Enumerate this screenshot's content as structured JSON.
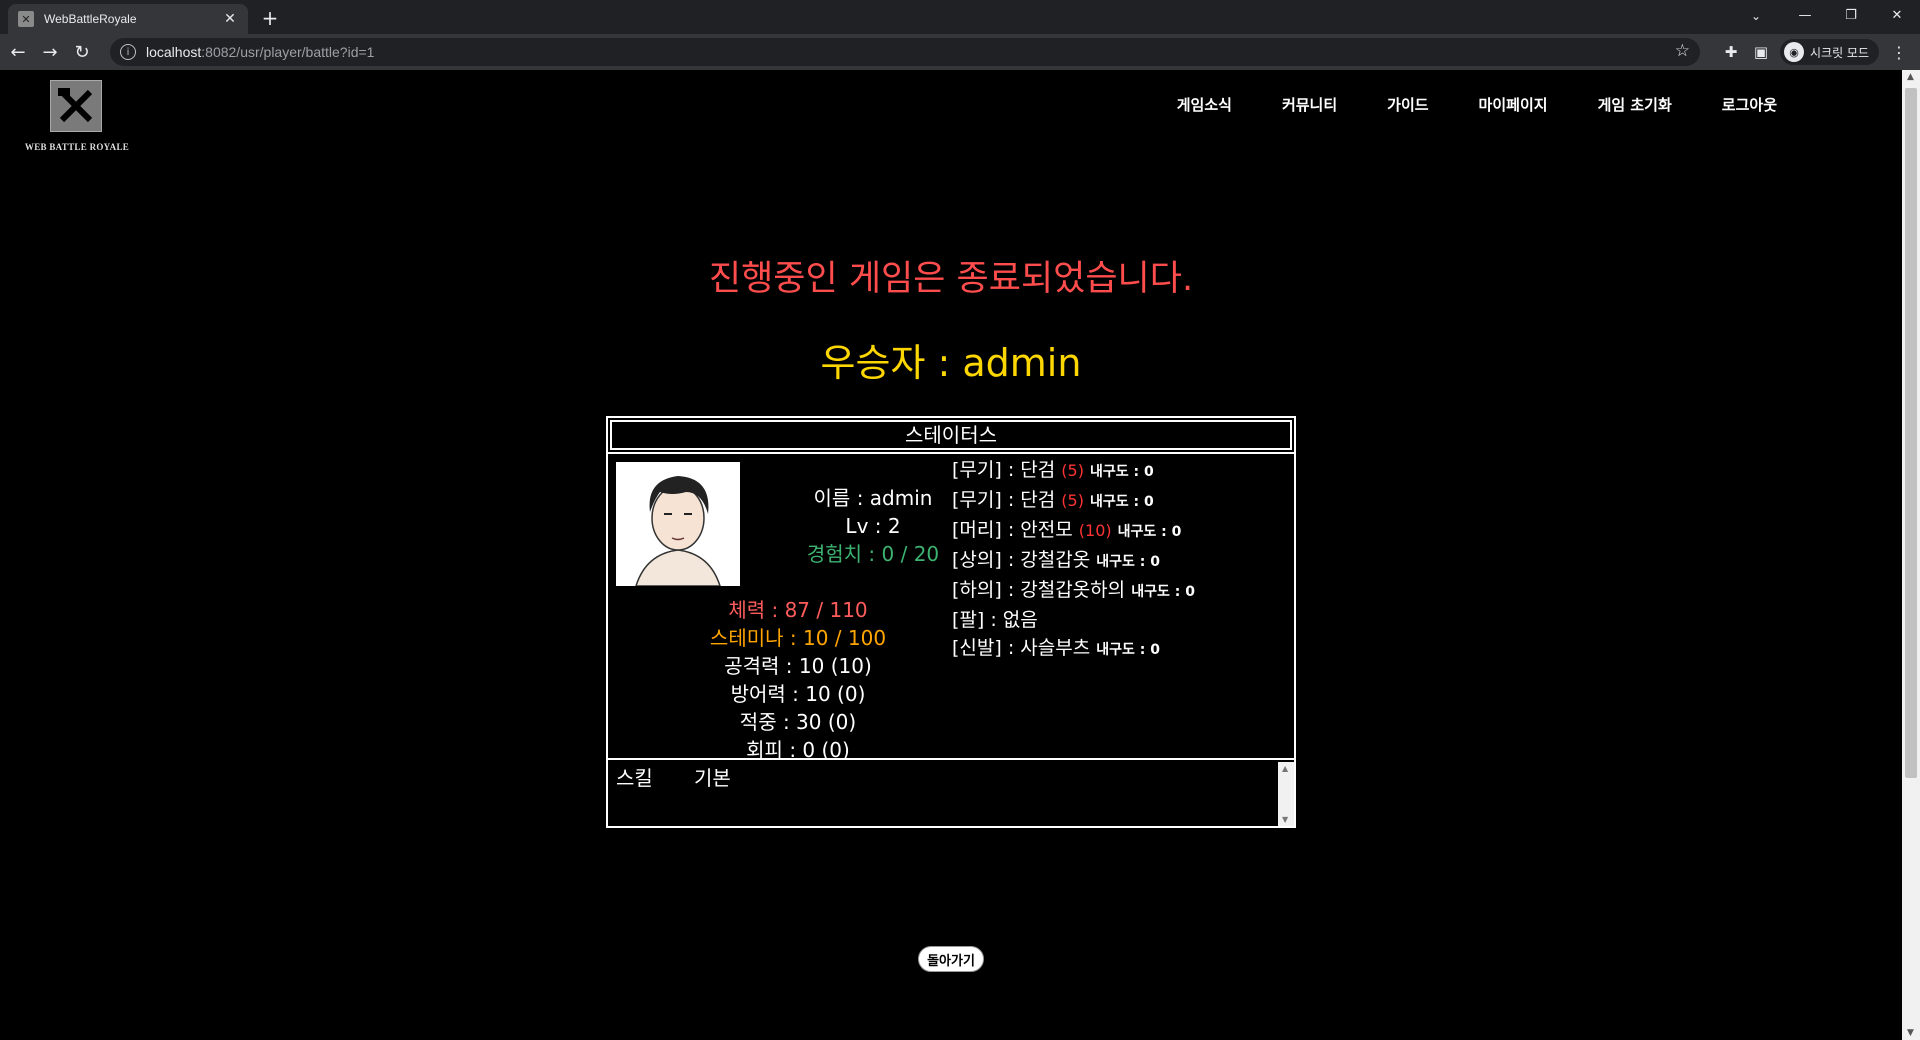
{
  "browser": {
    "tab_title": "WebBattleRoyale",
    "url_host": "localhost",
    "url_rest": ":8082/usr/player/battle?id=1",
    "incognito_label": "시크릿 모드"
  },
  "header": {
    "logo_text": "WEB BATTLE ROYALE",
    "nav": [
      "게임소식",
      "커뮤니티",
      "가이드",
      "마이페이지",
      "게임 초기화",
      "로그아웃"
    ]
  },
  "main": {
    "end_message": "진행중인 게임은 종료되었습니다.",
    "winner": "우승자 : admin"
  },
  "status": {
    "title": "스테이터스",
    "name": "이름 : admin",
    "level": "Lv : 2",
    "exp": "경험치 : 0 / 20",
    "hp": "체력 : 87 / 110",
    "stamina": "스테미나 : 10 / 100",
    "attack": "공격력 : 10 (10)",
    "defense": "방어력 : 10 (0)",
    "accuracy": "적중 : 30 (0)",
    "evasion": "회피 : 0 (0)",
    "equipment": [
      {
        "slot": "[무기] : 단검",
        "power": "(5)",
        "durability": "내구도 : 0"
      },
      {
        "slot": "[무기] : 단검",
        "power": "(5)",
        "durability": "내구도 : 0"
      },
      {
        "slot": "[머리] : 안전모",
        "power": "(10)",
        "durability": "내구도 : 0"
      },
      {
        "slot": "[상의] : 강철갑옷",
        "power": "",
        "durability": "내구도 : 0"
      },
      {
        "slot": "[하의] : 강철갑옷하의",
        "power": "",
        "durability": "내구도 : 0"
      },
      {
        "slot": "[팔] : 없음",
        "power": "",
        "durability": ""
      },
      {
        "slot": "[신발] : 사슬부츠",
        "power": "",
        "durability": "내구도 : 0"
      }
    ],
    "skill_label": "스킬",
    "skill_value": "기본"
  },
  "back_button": "돌아가기"
}
